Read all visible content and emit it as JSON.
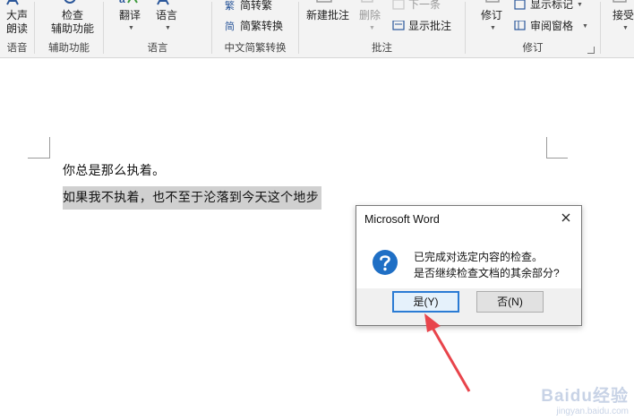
{
  "ribbon": {
    "groups": [
      {
        "label": "语音",
        "button_line1": "大声",
        "button_line2": "朗读"
      },
      {
        "label": "辅助功能",
        "button_line1": "检查",
        "button_line2": "辅助功能"
      },
      {
        "label": "语言",
        "translate": "翻译",
        "language": "语言"
      },
      {
        "label": "中文简繁转换",
        "simp_to_trad": "简转繁",
        "trad_to_simp": "简繁转换"
      },
      {
        "label": "批注",
        "new_comment": "新建批注",
        "delete": "删除",
        "next": "下一条",
        "show_comments": "显示批注"
      },
      {
        "label": "修订",
        "track": "修订",
        "show_markup": "显示标记",
        "review_pane": "审阅窗格"
      },
      {
        "label": "",
        "accept": "接受"
      }
    ]
  },
  "document": {
    "line1": "你总是那么执着。",
    "line2": "如果我不执着，也不至于沦落到今天这个地步"
  },
  "dialog": {
    "title": "Microsoft Word",
    "message_line1": "已完成对选定内容的检查。",
    "message_line2": "是否继续检查文档的其余部分?",
    "yes_button": "是(Y)",
    "no_button": "否(N)"
  },
  "watermark": {
    "main": "Baidu经验",
    "sub": "jingyan.baidu.com"
  },
  "colors": {
    "accent": "#2a7bd4",
    "arrow": "#e8444b",
    "selection": "#d0d0d0"
  }
}
